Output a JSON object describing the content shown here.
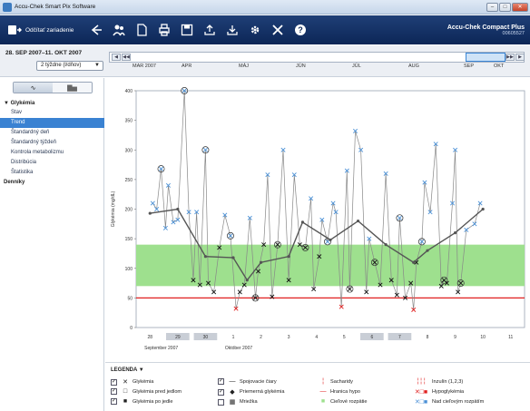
{
  "window": {
    "title": "Accu-Chek Smart Pix Software",
    "minimize": "–",
    "maximize": "□",
    "close": "✕"
  },
  "toolbar": {
    "read_device_label": "Odčítať zariadenie",
    "device_name": "Accu-Chek Compact Plus",
    "device_serial": "00605527",
    "icons": [
      "back-icon",
      "users-icon",
      "report-icon",
      "print-icon",
      "save-icon",
      "export-icon",
      "import-icon",
      "settings-icon",
      "tools-icon",
      "help-icon"
    ]
  },
  "period": {
    "range": "28. SEP 2007–11. OKT 2007",
    "selected": "2 týždne (l/dňov)"
  },
  "timeline": {
    "months": [
      "MAR 2007",
      "APR",
      "MÁJ",
      "JÚN",
      "JÚL",
      "AUG",
      "SEP",
      "OKT"
    ],
    "nav_left": [
      "◀",
      "◀◀"
    ],
    "nav_right": [
      "▶▶",
      "▶"
    ]
  },
  "sidebar": {
    "view_toggle": [
      "∿",
      "▇▅"
    ],
    "group_label": "▼ Glykémia",
    "items": [
      "Stav",
      "Trend",
      "Štandardný deň",
      "Štandardný týždeň",
      "Kontrola metabolizmu",
      "Distribúcia",
      "Štatistika"
    ],
    "selected_index": 1,
    "diaries_label": "Denníky"
  },
  "legend": {
    "title": "LEGENDA ▼",
    "col1": [
      "Glykémia",
      "Glykémia pred jedlom",
      "Glykémia po jedle"
    ],
    "col2": [
      "Spojovacie čiary",
      "Priemerná glykémia",
      "Mriežka"
    ],
    "col3": [
      "Sacharidy",
      "Hranica hypo",
      "Cieľové rozpätie"
    ],
    "col4": [
      "Inzulín (1,2,3)",
      "Hypoglykémia",
      "Nad cieľovým rozpätím"
    ]
  },
  "chart_data": {
    "type": "line",
    "ylabel": "Glykémia (mg/dL)",
    "ylim": [
      0,
      400
    ],
    "yticks": [
      0,
      50,
      100,
      150,
      200,
      250,
      300,
      350,
      400
    ],
    "x_days": [
      "28",
      "29",
      "30",
      "1",
      "2",
      "3",
      "4",
      "5",
      "6",
      "7",
      "8",
      "9",
      "10",
      "11"
    ],
    "x_month_labels": [
      "September 2007",
      "Október 2007"
    ],
    "weekend_days": [
      "29",
      "30",
      "6",
      "7"
    ],
    "target_range": [
      70,
      140
    ],
    "hypo_limit": 50,
    "colors": {
      "target": "#9ee08e",
      "hypo": "#e02020",
      "series": "#888888",
      "average": "#555555",
      "marker_after": "#4a90d6"
    },
    "glucose": [
      [
        0.05,
        210
      ],
      [
        0.12,
        200
      ],
      [
        0.2,
        268
      ],
      [
        0.28,
        168
      ],
      [
        0.33,
        240
      ],
      [
        0.42,
        178
      ],
      [
        0.5,
        182
      ],
      [
        0.62,
        400
      ],
      [
        0.7,
        195
      ],
      [
        0.78,
        80
      ],
      [
        0.84,
        195
      ],
      [
        0.9,
        72
      ],
      [
        1.0,
        300
      ],
      [
        1.05,
        75
      ],
      [
        1.15,
        60
      ],
      [
        1.25,
        135
      ],
      [
        1.35,
        190
      ],
      [
        1.45,
        155
      ],
      [
        1.55,
        32
      ],
      [
        1.62,
        60
      ],
      [
        1.7,
        72
      ],
      [
        1.8,
        185
      ],
      [
        1.9,
        50
      ],
      [
        1.95,
        95
      ],
      [
        2.05,
        140
      ],
      [
        2.12,
        258
      ],
      [
        2.2,
        52
      ],
      [
        2.3,
        140
      ],
      [
        2.4,
        300
      ],
      [
        2.5,
        80
      ],
      [
        2.6,
        258
      ],
      [
        2.7,
        140
      ],
      [
        2.8,
        135
      ],
      [
        2.9,
        218
      ],
      [
        2.95,
        65
      ],
      [
        3.05,
        120
      ],
      [
        3.1,
        182
      ],
      [
        3.2,
        145
      ],
      [
        3.3,
        210
      ],
      [
        3.35,
        195
      ],
      [
        3.45,
        35
      ],
      [
        3.55,
        265
      ],
      [
        3.6,
        65
      ],
      [
        3.7,
        332
      ],
      [
        3.8,
        300
      ],
      [
        3.9,
        60
      ],
      [
        3.95,
        150
      ],
      [
        4.05,
        110
      ],
      [
        4.15,
        72
      ],
      [
        4.25,
        260
      ],
      [
        4.35,
        80
      ],
      [
        4.45,
        55
      ],
      [
        4.5,
        185
      ],
      [
        4.6,
        50
      ],
      [
        4.7,
        75
      ],
      [
        4.75,
        30
      ],
      [
        4.8,
        110
      ],
      [
        4.9,
        145
      ],
      [
        4.95,
        245
      ],
      [
        5.05,
        195
      ],
      [
        5.15,
        310
      ],
      [
        5.25,
        70
      ],
      [
        5.3,
        80
      ],
      [
        5.35,
        75
      ],
      [
        5.45,
        210
      ],
      [
        5.5,
        300
      ],
      [
        5.55,
        60
      ],
      [
        5.6,
        75
      ],
      [
        5.7,
        165
      ],
      [
        5.85,
        175
      ],
      [
        5.95,
        210
      ]
    ],
    "average": [
      [
        0.0,
        193
      ],
      [
        0.5,
        200
      ],
      [
        1.0,
        120
      ],
      [
        1.5,
        118
      ],
      [
        1.75,
        80
      ],
      [
        2.0,
        110
      ],
      [
        2.5,
        120
      ],
      [
        2.75,
        178
      ],
      [
        3.25,
        148
      ],
      [
        3.75,
        180
      ],
      [
        4.25,
        140
      ],
      [
        4.75,
        110
      ],
      [
        5.0,
        130
      ],
      [
        5.5,
        160
      ],
      [
        6.0,
        200
      ]
    ]
  }
}
